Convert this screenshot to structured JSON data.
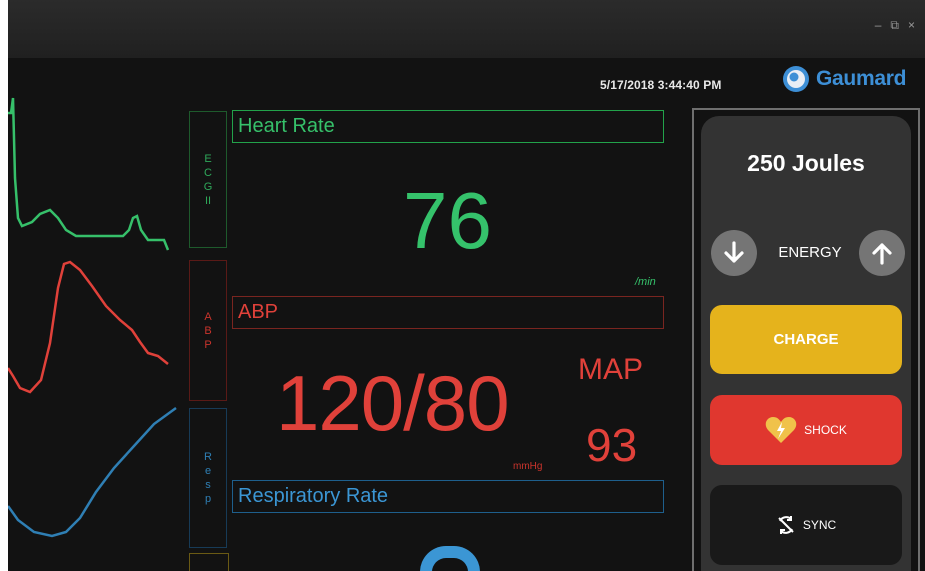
{
  "window_controls": {
    "minimize": "–",
    "restore": "⧉",
    "close": "×"
  },
  "header": {
    "datetime": "5/17/2018 3:44:40 PM",
    "brand": "Gaumard"
  },
  "side_labels": {
    "ecg": "ECGII",
    "abp": "ABP",
    "resp": "Resp"
  },
  "heart_rate": {
    "title": "Heart Rate",
    "value": "76",
    "unit": "/min"
  },
  "abp": {
    "title": "ABP",
    "value": "120/80",
    "unit": "mmHg",
    "map_label": "MAP",
    "map_value": "93"
  },
  "respiratory_rate": {
    "title": "Respiratory Rate"
  },
  "defib": {
    "energy_amount": "250 Joules",
    "energy_label": "ENERGY",
    "charge_label": "CHARGE",
    "shock_label": "SHOCK",
    "sync_label": "SYNC"
  },
  "colors": {
    "ecg": "#36c06a",
    "abp": "#e0413a",
    "resp": "#3b96d4",
    "charge": "#e5b31c",
    "shock": "#e0372f"
  },
  "icons": [
    "arrow-down-icon",
    "arrow-up-icon",
    "heart-bolt-icon",
    "sync-off-icon",
    "gaumard-logo-icon"
  ]
}
